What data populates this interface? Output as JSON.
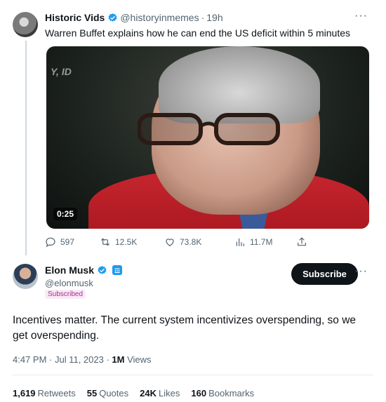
{
  "parent_tweet": {
    "name": "Historic Vids",
    "handle": "@historyinmemes",
    "separator": "·",
    "time": "19h",
    "more": "···",
    "text": "Warren Buffet explains how he can end the US deficit within 5 minutes",
    "video": {
      "overlay_text": "Y, ID",
      "duration": "0:25"
    },
    "actions": {
      "replies": "597",
      "retweets": "12.5K",
      "likes": "73.8K",
      "views": "11.7M"
    },
    "accent_color": "#1d9bf0"
  },
  "main_tweet": {
    "name": "Elon Musk",
    "handle": "@elonmusk",
    "badge": "Subscribed",
    "subscribe_label": "Subscribe",
    "more": "···",
    "text": "Incentives matter. The current system incentivizes overspending, so we get overspending.",
    "timestamp": "4:47 PM · Jul 11, 2023 ·",
    "views_count": "1M",
    "views_label": "Views",
    "stats": {
      "retweets_count": "1,619",
      "retweets_label": "Retweets",
      "quotes_count": "55",
      "quotes_label": "Quotes",
      "likes_count": "24K",
      "likes_label": "Likes",
      "bookmarks_count": "160",
      "bookmarks_label": "Bookmarks"
    }
  },
  "icons": [
    "verified-badge-icon",
    "reply-icon",
    "retweet-icon",
    "like-icon",
    "views-icon",
    "share-icon",
    "government-badge-icon"
  ]
}
